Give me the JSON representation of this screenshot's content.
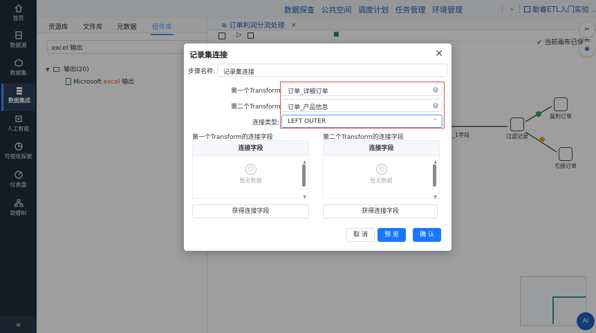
{
  "nav": {
    "items": [
      {
        "label": "首页",
        "icon": "home-icon"
      },
      {
        "label": "数据源",
        "icon": "datasource-icon"
      },
      {
        "label": "数据集",
        "icon": "dataset-icon"
      },
      {
        "label": "数据集成",
        "icon": "integration-icon"
      },
      {
        "label": "人工智能",
        "icon": "ai-icon"
      },
      {
        "label": "可视化探索",
        "icon": "visual-explore-icon"
      },
      {
        "label": "仪表盘",
        "icon": "dashboard-icon"
      },
      {
        "label": "助睿BI",
        "icon": "org-icon"
      }
    ],
    "collapse": "«"
  },
  "topbar": {
    "menu": [
      "数据探查",
      "公共空间",
      "调度计划",
      "任务管理",
      "环境管理"
    ],
    "tenant": "助睿ETL入门实验 ..."
  },
  "left_panel": {
    "tabs": [
      "资源库",
      "文件库",
      "元数据",
      "组件库"
    ],
    "search_value": "excel 输出",
    "tree": {
      "folder": "输出(20)",
      "item_prefix": "Microsoft ",
      "item_highlight": "excel",
      "item_suffix": " 输出"
    }
  },
  "canvas": {
    "tab_label": "订单利润分流处理",
    "status": "当前画布已保存",
    "nodes": {
      "partial_label": "_1字段",
      "filter": "过滤记录",
      "profit": "盈利订单",
      "loss": "亏损订单"
    }
  },
  "modal": {
    "title": "记录集连接",
    "step_name_label": "步骤名称:",
    "step_name_value": "记录集连接",
    "first_transform_label": "第一个Transform:",
    "first_transform_value": "订单_详细订单",
    "second_transform_label": "第二个Transform:",
    "second_transform_value": "订单_产品信息",
    "join_type_label": "连接类型:",
    "join_type_value": "LEFT OUTER",
    "left_section_title": "第一个Transform的连接字段",
    "right_section_title": "第二个Transform的连接字段",
    "pane_header": "连接字段",
    "empty_text": "暂无数据",
    "get_fields_button": "获得连接字段",
    "cancel_button": "取 消",
    "preview_button": "预 览",
    "confirm_button": "确 认"
  },
  "ai_button": "AI",
  "colors": {
    "accent": "#409eff",
    "primary_button": "#1677ff",
    "nav_bg": "#1f2d3d",
    "highlight_border": "#e05050"
  }
}
